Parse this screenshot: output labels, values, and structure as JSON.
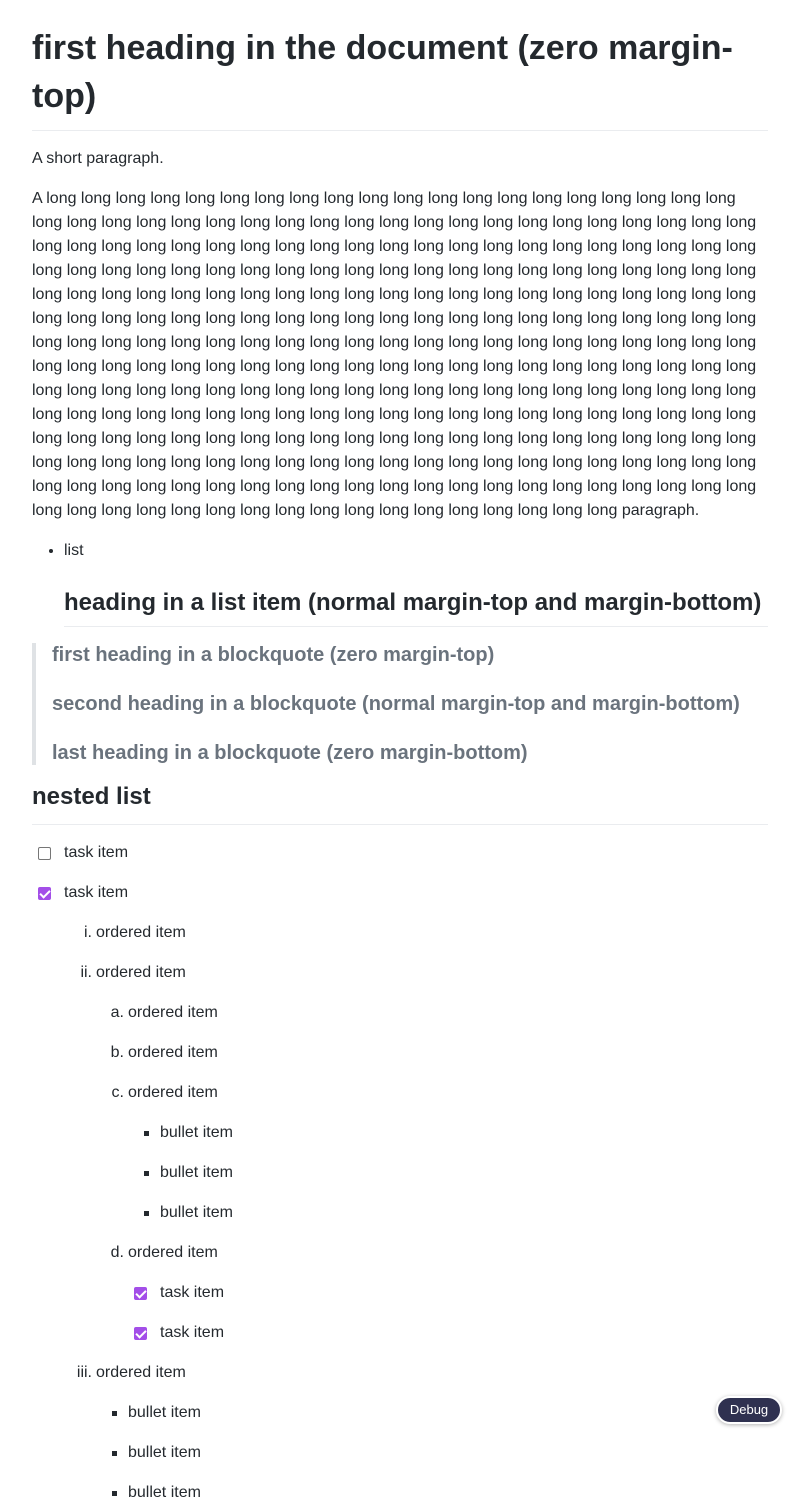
{
  "title": "first heading in the document (zero margin-top)",
  "short_paragraph": "A short paragraph.",
  "long_paragraph": "A long long long long long long long long long long long long long long long long long long long long long long long long long long long long long long long long long long long long long long long long long long long long long long long long long long long long long long long long long long long long long long long long long long long long long long long long long long long long long long long long long long long long long long long long long long long long long long long long long long long long long long long long long long long long long long long long long long long long long long long long long long long long long long long long long long long long long long long long long long long long long long long long long long long long long long long long long long long long long long long long long long long long long long long long long long long long long long long long long long long long long long long long long long long long long long long long long long long long long long long long long long long long long long long long long long long long long long long long long long long long long long long long long long long long long long long long long long long long long long long long long long long long long long long long long long long long long long long long long long long long long long long long long long long long long long long long long long long long long long long long long long long long long long long long long paragraph.",
  "list": {
    "item": "list",
    "heading": "heading in a list item (normal margin-top and margin-bottom)"
  },
  "blockquote": {
    "first": "first heading in a blockquote (zero margin-top)",
    "second": "second heading in a blockquote (normal margin-top and margin-bottom)",
    "last": "last heading in a blockquote (zero margin-bottom)"
  },
  "nested": {
    "heading": "nested list",
    "task_label": "task item",
    "ordered_label": "ordered item",
    "bullet_label": "bullet item",
    "markers": {
      "i": "i.",
      "ii": "ii.",
      "iii": "iii.",
      "a": "a.",
      "b": "b.",
      "c": "c.",
      "d": "d."
    },
    "tasks": [
      {
        "checked": false
      },
      {
        "checked": true
      },
      {
        "checked": true
      },
      {
        "checked": true
      }
    ]
  },
  "debug_button": "Debug",
  "colors": {
    "checkbox_accent": "#a34ee8",
    "debug_bg": "#2f3150",
    "quote_text": "#6a737d"
  }
}
